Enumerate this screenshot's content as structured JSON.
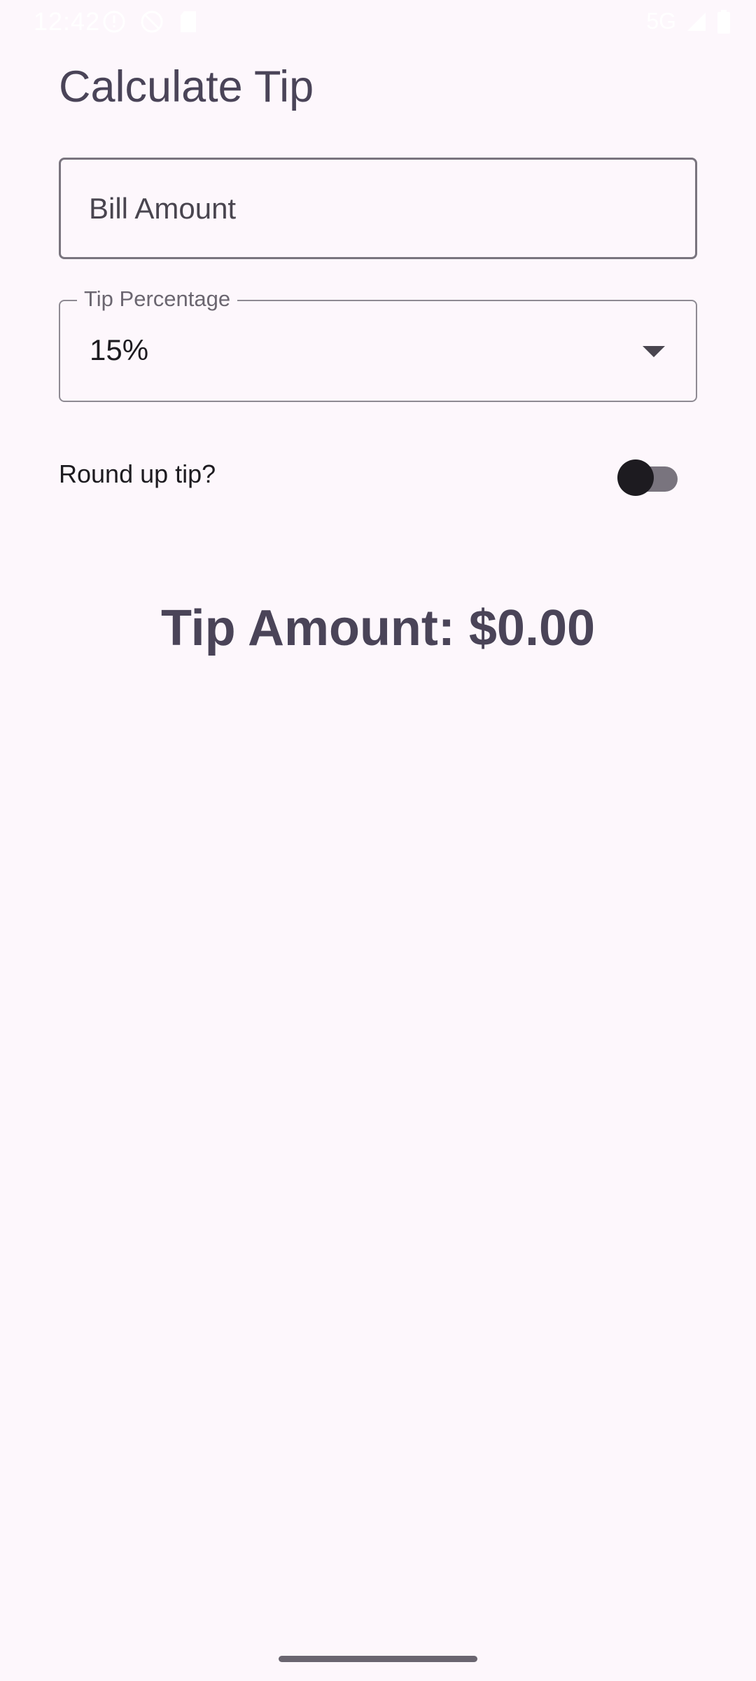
{
  "status_bar": {
    "time": "12:42",
    "network": "5G",
    "left_icons": [
      "alert-circle-icon",
      "do-not-disturb-icon",
      "sd-card-icon"
    ],
    "right_icons": [
      "signal-icon",
      "battery-icon"
    ]
  },
  "screen": {
    "title": "Calculate Tip"
  },
  "bill_input": {
    "placeholder": "Bill Amount",
    "value": ""
  },
  "tip_select": {
    "label": "Tip Percentage",
    "selected": "15%"
  },
  "round_up": {
    "label": "Round up tip?",
    "checked": false
  },
  "result": {
    "text": "Tip Amount: $0.00"
  },
  "colors": {
    "background": "#fdf7fc",
    "primary_text": "#4a4458",
    "outline": "#79747e"
  }
}
